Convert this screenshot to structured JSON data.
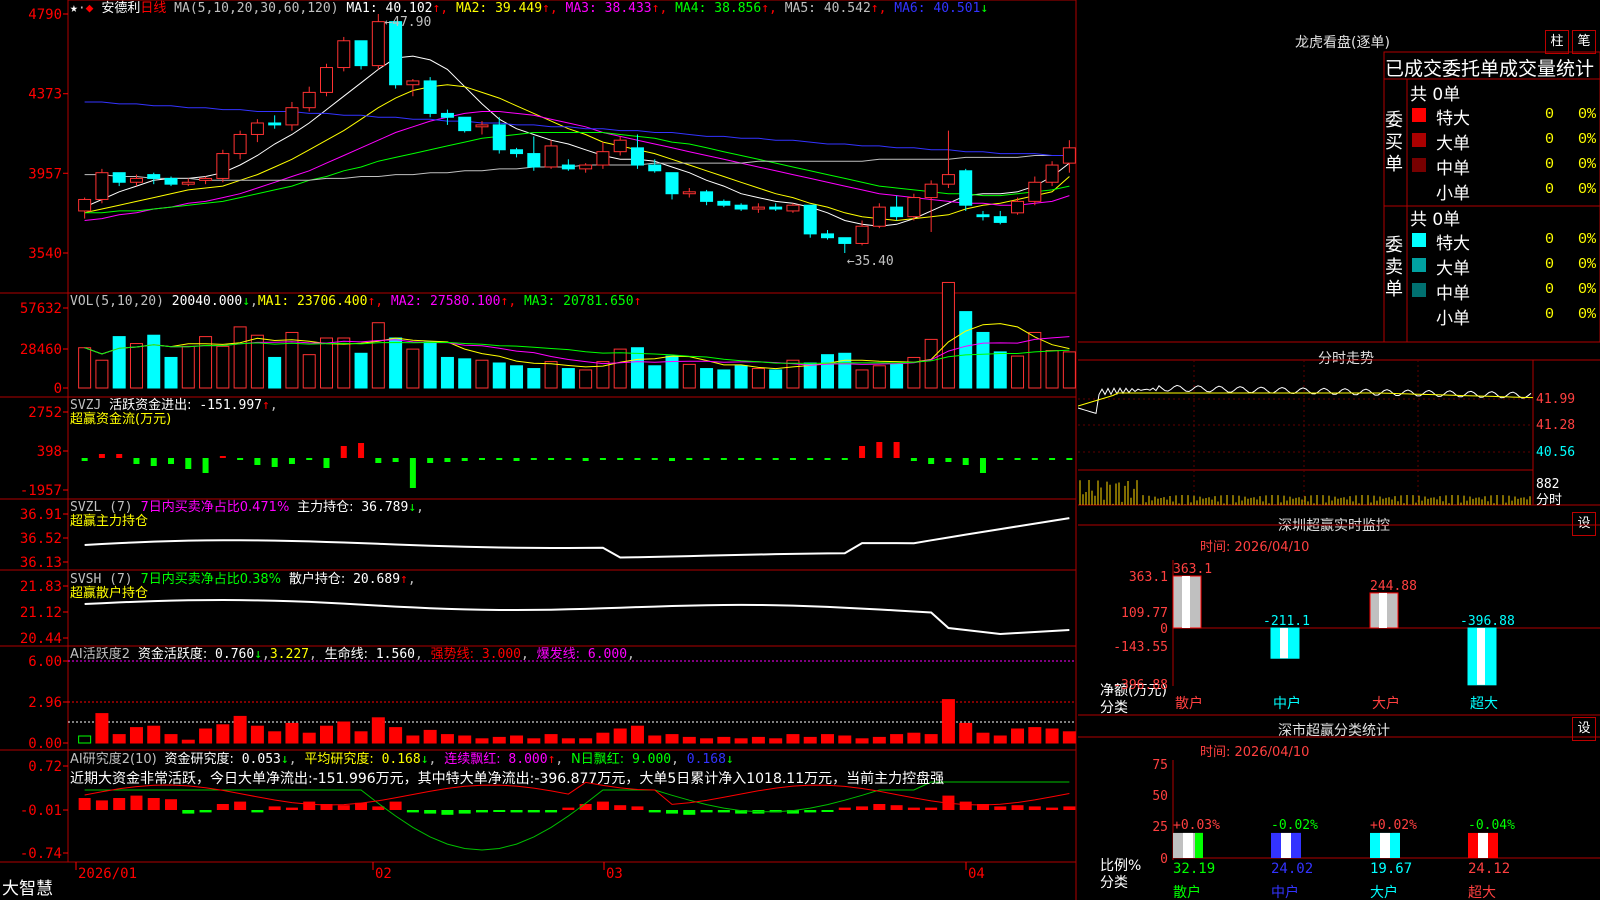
{
  "header": {
    "title": "安德利",
    "period": "日线",
    "ma_label": "MA(5,10,20,30,60,120)",
    "ma": [
      {
        "k": "MA1:",
        "v": "40.102",
        "d": "↑",
        "color": "#ffffff"
      },
      {
        "k": "MA2:",
        "v": "39.449",
        "d": "↑",
        "color": "#ffff00"
      },
      {
        "k": "MA3:",
        "v": "38.433",
        "d": "↑",
        "color": "#ff00ff"
      },
      {
        "k": "MA4:",
        "v": "38.856",
        "d": "↑",
        "color": "#00ff00"
      },
      {
        "k": "MA5:",
        "v": "40.542",
        "d": "↑",
        "color": "#c0c0c0"
      },
      {
        "k": "MA6:",
        "v": "40.501",
        "d": "↓",
        "color": "#3333ff"
      }
    ],
    "high_label": "47.90",
    "low_label": "35.40"
  },
  "price_axis": [
    "4790",
    "4373",
    "3957",
    "3540"
  ],
  "vol": {
    "title": "VOL(5,10,20)",
    "value": "20040.000",
    "d": "↓",
    "ma": [
      {
        "k": "MA1:",
        "v": "23706.400",
        "d": "↑"
      },
      {
        "k": "MA2:",
        "v": "27580.100",
        "d": "↑"
      },
      {
        "k": "MA3:",
        "v": "20781.650",
        "d": "↑"
      }
    ],
    "axis": [
      "57632",
      "28460",
      "0"
    ]
  },
  "svzj": {
    "title": "SVZJ",
    "desc": "活跃资金进出:",
    "value": "-151.997",
    "d": "↑",
    "sub": "超赢资金流(万元)",
    "axis": [
      "2752",
      "398",
      "-1957"
    ]
  },
  "svzl": {
    "title": "SVZL (7)",
    "note": "7日内买卖净占比0.471%",
    "k": "主力持仓:",
    "v": "36.789",
    "d": "↓",
    "sub": "超赢主力持仓",
    "axis": [
      "36.91",
      "36.52",
      "36.13"
    ]
  },
  "svsh": {
    "title": "SVSH (7)",
    "note": "7日内买卖净占比0.38%",
    "k": "散户持仓:",
    "v": "20.689",
    "d": "↑",
    "sub": "超赢散户持仓",
    "axis": [
      "21.83",
      "21.12",
      "20.44"
    ]
  },
  "ai1": {
    "title": "AI活跃度2",
    "k": "资金活跃度:",
    "v": "0.760",
    "d": "↓",
    "v2": "3.227",
    "k3": "生命线:",
    "v3": "1.560",
    "k4": "强势线:",
    "v4": "3.000",
    "k5": "爆发线:",
    "v5": "6.000",
    "axis": [
      "6.00",
      "2.96",
      "0.00"
    ]
  },
  "ai2": {
    "title": "AI研究度2(10)",
    "k": "资金研究度:",
    "v": "0.053",
    "d": "↓",
    "k2": "平均研究度:",
    "v2": "0.168",
    "k3": "连续飘红:",
    "v3": "8.000",
    "k4": "N日飘红:",
    "v4": "9.000",
    "v5": "0.168",
    "comment": "近期大资金非常活跃，今日大单净流出:-151.996万元，其中特大单净流出:-396.877万元，大单5日累计净入1018.11万元，当前主力控盘强",
    "axis": [
      "0.72",
      "-0.01",
      "-0.74"
    ]
  },
  "date_axis": [
    "2026/01",
    "02",
    "03",
    "04"
  ],
  "brand": "大智慧",
  "lhb": {
    "title": "龙虎看盘(逐单)",
    "btn1": "柱",
    "btn2": "笔",
    "tab": "已成交委托单成交量统计",
    "buy_label": "委买单",
    "sell_label": "委卖单",
    "buy_total": "共 0单",
    "sell_total": "共 0单",
    "buy": [
      {
        "name": "特大",
        "n": "0",
        "p": "0%",
        "color": "#ff0000"
      },
      {
        "name": "大单",
        "n": "0",
        "p": "0%",
        "color": "#aa0000"
      },
      {
        "name": "中单",
        "n": "0",
        "p": "0%",
        "color": "#770000"
      },
      {
        "name": "小单",
        "n": "0",
        "p": "0%",
        "color": "#000000"
      }
    ],
    "sell": [
      {
        "name": "特大",
        "n": "0",
        "p": "0%",
        "color": "#00ffff"
      },
      {
        "name": "大单",
        "n": "0",
        "p": "0%",
        "color": "#00a0a0"
      },
      {
        "name": "中单",
        "n": "0",
        "p": "0%",
        "color": "#007070"
      },
      {
        "name": "小单",
        "n": "0",
        "p": "0%",
        "color": "#000000"
      }
    ]
  },
  "fenshi": {
    "title": "分时走势",
    "axis": [
      "41.99",
      "41.28",
      "40.56"
    ],
    "vol_axis": "882",
    "vol_unit": "分时"
  },
  "szmon": {
    "title": "深圳超赢实时监控",
    "btn": "设",
    "time": "时间: 2026/04/10",
    "axis": [
      "363.1",
      "109.77",
      "0",
      "-143.55",
      "-396.88"
    ],
    "ylabel1": "净额(万元)",
    "ylabel2": "分类",
    "bars": [
      {
        "cat": "散户",
        "value": "363.1"
      },
      {
        "cat": "中户",
        "value": "-211.1"
      },
      {
        "cat": "大户",
        "value": "244.88"
      },
      {
        "cat": "超大",
        "value": "-396.88"
      }
    ]
  },
  "szcls": {
    "title": "深市超赢分类统计",
    "btn": "设",
    "time": "时间: 2026/04/10",
    "axis": [
      "75",
      "50",
      "25",
      "0"
    ],
    "ylabel1": "比例%",
    "ylabel2": "分类",
    "bars": [
      {
        "cat": "散户",
        "pct": "+0.03%",
        "val": "32.19"
      },
      {
        "cat": "中户",
        "pct": "-0.02%",
        "val": "24.02"
      },
      {
        "cat": "大户",
        "pct": "+0.02%",
        "val": "19.67"
      },
      {
        "cat": "超大",
        "pct": "-0.04%",
        "val": "24.12"
      }
    ]
  },
  "chart_data": {
    "type": "candlestick",
    "candles": [
      [
        37.6,
        38.3,
        37.2,
        38.2
      ],
      [
        38.2,
        39.8,
        38.0,
        39.6
      ],
      [
        39.6,
        39.4,
        38.9,
        39.1
      ],
      [
        39.1,
        39.5,
        38.9,
        39.3
      ],
      [
        39.5,
        39.6,
        39.0,
        39.3
      ],
      [
        39.3,
        39.4,
        38.9,
        39.0
      ],
      [
        39.0,
        39.3,
        38.9,
        39.1
      ],
      [
        39.2,
        39.4,
        39.0,
        39.3
      ],
      [
        39.3,
        40.8,
        39.1,
        40.6
      ],
      [
        40.6,
        41.8,
        40.3,
        41.6
      ],
      [
        41.6,
        42.4,
        41.2,
        42.2
      ],
      [
        42.2,
        42.6,
        41.9,
        42.1
      ],
      [
        42.1,
        43.3,
        41.8,
        43.0
      ],
      [
        43.0,
        44.1,
        42.8,
        43.8
      ],
      [
        43.8,
        45.3,
        43.6,
        45.1
      ],
      [
        45.1,
        46.7,
        44.9,
        46.5
      ],
      [
        46.5,
        46.4,
        45.0,
        45.2
      ],
      [
        45.2,
        47.9,
        45.0,
        47.5
      ],
      [
        47.5,
        47.3,
        44.0,
        44.2
      ],
      [
        44.2,
        44.5,
        43.6,
        44.4
      ],
      [
        44.4,
        44.6,
        42.5,
        42.7
      ],
      [
        42.7,
        42.9,
        42.1,
        42.5
      ],
      [
        42.5,
        42.2,
        41.7,
        41.8
      ],
      [
        42.0,
        42.3,
        41.6,
        42.1
      ],
      [
        42.1,
        42.5,
        40.6,
        40.8
      ],
      [
        40.8,
        40.9,
        40.4,
        40.6
      ],
      [
        40.6,
        41.5,
        39.7,
        39.9
      ],
      [
        39.9,
        41.3,
        39.8,
        41.0
      ],
      [
        40.0,
        40.3,
        39.7,
        39.8
      ],
      [
        39.8,
        40.1,
        39.6,
        40.0
      ],
      [
        40.0,
        41.2,
        39.8,
        40.7
      ],
      [
        40.7,
        41.5,
        40.5,
        41.3
      ],
      [
        40.9,
        41.6,
        39.8,
        40.0
      ],
      [
        40.0,
        40.3,
        39.6,
        39.7
      ],
      [
        39.6,
        39.4,
        38.2,
        38.5
      ],
      [
        38.5,
        38.8,
        38.3,
        38.6
      ],
      [
        38.6,
        38.7,
        37.9,
        38.1
      ],
      [
        38.1,
        38.2,
        37.8,
        37.9
      ],
      [
        37.9,
        38.0,
        37.6,
        37.7
      ],
      [
        37.7,
        38.0,
        37.5,
        37.8
      ],
      [
        37.8,
        38.0,
        37.6,
        37.7
      ],
      [
        37.6,
        38.0,
        37.5,
        37.9
      ],
      [
        37.9,
        37.8,
        36.2,
        36.4
      ],
      [
        36.4,
        36.6,
        36.1,
        36.2
      ],
      [
        36.2,
        36.0,
        35.4,
        35.9
      ],
      [
        35.9,
        37.1,
        35.8,
        36.8
      ],
      [
        36.8,
        38.0,
        36.7,
        37.8
      ],
      [
        37.8,
        38.4,
        37.1,
        37.3
      ],
      [
        37.3,
        38.5,
        37.1,
        38.3
      ],
      [
        38.3,
        39.2,
        36.5,
        39.0
      ],
      [
        39.0,
        41.8,
        38.8,
        39.5
      ],
      [
        39.7,
        39.8,
        37.6,
        37.9
      ],
      [
        37.4,
        37.6,
        37.1,
        37.3
      ],
      [
        37.3,
        37.6,
        36.9,
        37.0
      ],
      [
        37.5,
        38.3,
        37.4,
        38.1
      ],
      [
        38.1,
        39.4,
        37.9,
        39.1
      ],
      [
        39.1,
        40.2,
        38.9,
        40.0
      ],
      [
        40.1,
        41.3,
        39.6,
        40.9
      ]
    ],
    "vol": [
      2.9,
      2.0,
      3.7,
      3.2,
      3.8,
      2.2,
      3.0,
      3.7,
      3.0,
      4.4,
      3.8,
      2.2,
      4.0,
      2.4,
      3.6,
      3.6,
      2.5,
      4.7,
      3.6,
      2.8,
      3.3,
      2.2,
      2.1,
      2.0,
      1.8,
      1.6,
      1.4,
      1.9,
      1.4,
      1.3,
      1.9,
      2.8,
      2.9,
      1.6,
      2.3,
      1.7,
      1.4,
      1.3,
      1.6,
      1.4,
      1.3,
      2.0,
      1.8,
      2.4,
      2.5,
      1.3,
      1.6,
      1.7,
      2.2,
      3.5,
      7.6,
      5.5,
      4.0,
      2.6,
      2.3,
      4.0,
      2.7,
      2.6
    ],
    "ylim": [
      35.4,
      47.9
    ],
    "dates": [
      "2026/01",
      "02",
      "03",
      "04"
    ],
    "series": [
      {
        "name": "MA1",
        "values": [
          37.8,
          38.2,
          38.6,
          38.9,
          39.2,
          39.3,
          39.3,
          39.4,
          39.6,
          40.0,
          40.5,
          41.1,
          41.6,
          42.2,
          42.9,
          43.6,
          44.3,
          45.0,
          45.6,
          45.7,
          45.5,
          45.0,
          44.1,
          43.2,
          42.4,
          41.9,
          41.6,
          41.3,
          41.1,
          40.8,
          40.5,
          40.3,
          40.3,
          40.2,
          39.9,
          39.6,
          39.2,
          38.9,
          38.5,
          38.3,
          38.1,
          38.0,
          37.8,
          37.5,
          37.1,
          36.9,
          36.8,
          36.9,
          37.2,
          37.6,
          38.0,
          38.4,
          38.5,
          38.5,
          38.6,
          38.9,
          39.4,
          40.1
        ]
      },
      {
        "name": "MA2",
        "values": [
          37.5,
          37.7,
          37.9,
          38.1,
          38.3,
          38.5,
          38.7,
          38.8,
          38.9,
          39.2,
          39.5,
          39.9,
          40.3,
          40.8,
          41.3,
          41.8,
          42.4,
          43.0,
          43.5,
          43.9,
          44.1,
          44.2,
          44.1,
          43.8,
          43.5,
          43.1,
          42.7,
          42.3,
          41.9,
          41.6,
          41.2,
          41.0,
          40.8,
          40.6,
          40.3,
          40.0,
          39.7,
          39.4,
          39.1,
          38.8,
          38.5,
          38.3,
          38.0,
          37.8,
          37.5,
          37.3,
          37.2,
          37.1,
          37.2,
          37.3,
          37.4,
          37.7,
          37.9,
          38.0,
          38.2,
          38.4,
          38.6,
          39.4
        ]
      },
      {
        "name": "MA3",
        "values": [
          37.1,
          37.2,
          37.4,
          37.5,
          37.7,
          37.8,
          38.0,
          38.1,
          38.3,
          38.5,
          38.8,
          39.1,
          39.4,
          39.7,
          40.1,
          40.5,
          40.9,
          41.3,
          41.7,
          42.0,
          42.3,
          42.5,
          42.7,
          42.8,
          42.8,
          42.7,
          42.6,
          42.4,
          42.2,
          42.0,
          41.7,
          41.5,
          41.3,
          41.1,
          40.9,
          40.7,
          40.5,
          40.3,
          40.1,
          39.9,
          39.7,
          39.5,
          39.3,
          39.1,
          38.9,
          38.7,
          38.5,
          38.4,
          38.3,
          38.2,
          38.1,
          38.0,
          38.0,
          37.9,
          37.9,
          38.0,
          38.1,
          38.4
        ]
      },
      {
        "name": "MA4",
        "values": [
          37.5,
          37.5,
          37.6,
          37.6,
          37.7,
          37.8,
          37.9,
          38.0,
          38.1,
          38.3,
          38.5,
          38.7,
          38.9,
          39.2,
          39.4,
          39.7,
          39.9,
          40.2,
          40.4,
          40.6,
          40.8,
          41.0,
          41.2,
          41.4,
          41.5,
          41.6,
          41.7,
          41.7,
          41.7,
          41.7,
          41.7,
          41.6,
          41.5,
          41.4,
          41.2,
          41.1,
          40.9,
          40.7,
          40.5,
          40.3,
          40.1,
          39.9,
          39.7,
          39.5,
          39.3,
          39.1,
          38.9,
          38.8,
          38.7,
          38.6,
          38.5,
          38.5,
          38.4,
          38.4,
          38.5,
          38.6,
          38.7,
          38.9
        ]
      },
      {
        "name": "MA5",
        "values": [
          39.5,
          39.5,
          39.4,
          39.4,
          39.3,
          39.3,
          39.3,
          39.2,
          39.2,
          39.2,
          39.2,
          39.2,
          39.2,
          39.2,
          39.3,
          39.3,
          39.4,
          39.4,
          39.5,
          39.5,
          39.6,
          39.6,
          39.7,
          39.7,
          39.8,
          39.8,
          39.9,
          39.9,
          39.9,
          40.0,
          40.0,
          40.0,
          40.0,
          40.1,
          40.1,
          40.1,
          40.1,
          40.1,
          40.1,
          40.2,
          40.2,
          40.2,
          40.2,
          40.2,
          40.2,
          40.2,
          40.3,
          40.3,
          40.3,
          40.3,
          40.3,
          40.4,
          40.4,
          40.4,
          40.4,
          40.5,
          40.5,
          40.5
        ]
      },
      {
        "name": "MA6",
        "values": [
          43.3,
          43.3,
          43.2,
          43.2,
          43.1,
          43.1,
          43.0,
          43.0,
          42.9,
          42.9,
          42.8,
          42.8,
          42.8,
          42.7,
          42.7,
          42.6,
          42.6,
          42.5,
          42.5,
          42.4,
          42.4,
          42.3,
          42.3,
          42.2,
          42.2,
          42.1,
          42.1,
          42.0,
          42.0,
          41.9,
          41.9,
          41.8,
          41.8,
          41.7,
          41.7,
          41.6,
          41.5,
          41.5,
          41.4,
          41.4,
          41.3,
          41.3,
          41.2,
          41.1,
          41.1,
          41.0,
          41.0,
          40.9,
          40.9,
          40.8,
          40.8,
          40.7,
          40.7,
          40.6,
          40.6,
          40.6,
          40.5,
          40.5
        ]
      }
    ]
  }
}
